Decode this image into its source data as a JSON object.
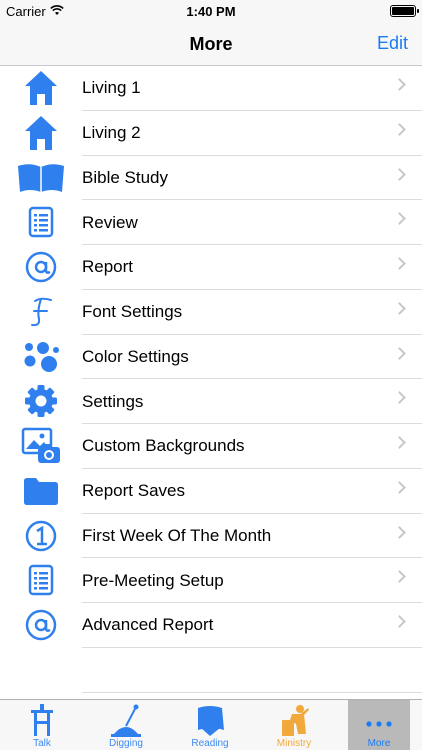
{
  "status_bar": {
    "carrier": "Carrier",
    "time": "1:40 PM",
    "battery_level": 1.0
  },
  "nav": {
    "title": "More",
    "edit_label": "Edit"
  },
  "colors": {
    "accent": "#1a7cf5",
    "icon_blue": "#2f80ee",
    "ministry": "#f2a93b",
    "separator": "#dcdcdf"
  },
  "menu": {
    "items": [
      {
        "label": "Living 1",
        "icon": "house-icon"
      },
      {
        "label": "Living 2",
        "icon": "house-icon"
      },
      {
        "label": "Bible Study",
        "icon": "open-book-icon"
      },
      {
        "label": "Review",
        "icon": "list-document-icon"
      },
      {
        "label": "Report",
        "icon": "at-sign-icon"
      },
      {
        "label": "Font Settings",
        "icon": "script-f-icon"
      },
      {
        "label": "Color Settings",
        "icon": "bubbles-icon"
      },
      {
        "label": "Settings",
        "icon": "gear-icon"
      },
      {
        "label": "Custom Backgrounds",
        "icon": "photo-camera-icon"
      },
      {
        "label": "Report Saves",
        "icon": "folder-icon"
      },
      {
        "label": "First Week Of The Month",
        "icon": "circled-one-icon"
      },
      {
        "label": "Pre-Meeting Setup",
        "icon": "list-document-icon"
      },
      {
        "label": "Advanced Report",
        "icon": "at-sign-icon"
      }
    ]
  },
  "tab_bar": {
    "tabs": [
      {
        "label": "Talk",
        "icon": "podium-icon"
      },
      {
        "label": "Digging",
        "icon": "shovel-icon"
      },
      {
        "label": "Reading",
        "icon": "reader-icon"
      },
      {
        "label": "Ministry",
        "icon": "preacher-icon"
      },
      {
        "label": "More",
        "icon": "more-dots-icon",
        "selected": true
      }
    ]
  }
}
